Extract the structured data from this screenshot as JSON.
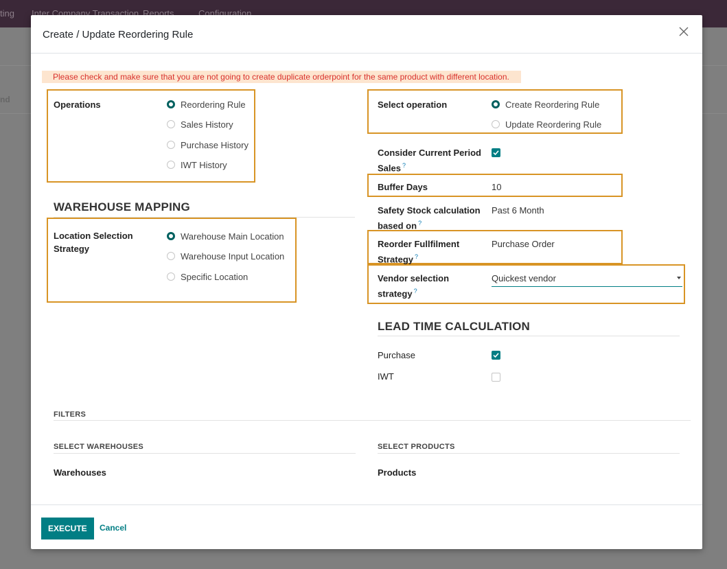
{
  "background": {
    "menu_items": [
      "ting",
      "Inter Company Transaction",
      "Reports",
      "Configuration"
    ],
    "left_label": "nd"
  },
  "modal": {
    "title": "Create / Update Reordering Rule",
    "warning": "Please check and make sure that you are not going to create duplicate orderpoint for the same product with different location."
  },
  "operations": {
    "label": "Operations",
    "options": [
      "Reordering Rule",
      "Sales History",
      "Purchase History",
      "IWT History"
    ],
    "selected": "Reordering Rule"
  },
  "select_operation": {
    "label": "Select operation",
    "options": [
      "Create Reordering Rule",
      "Update Reordering Rule"
    ],
    "selected": "Create Reordering Rule"
  },
  "consider_current_period": {
    "label_line1": "Consider Current Period",
    "label_line2": "Sales",
    "help": "?",
    "checked": true
  },
  "buffer_days": {
    "label": "Buffer Days",
    "value": "10"
  },
  "safety_stock": {
    "label_line1": "Safety Stock calculation",
    "label_line2": "based on",
    "help": "?",
    "value": "Past 6 Month"
  },
  "reorder_fulfilment": {
    "label_line1": "Reorder Fullfilment",
    "label_line2": "Strategy",
    "help": "?",
    "value": "Purchase Order"
  },
  "vendor_selection": {
    "label_line1": "Vendor selection",
    "label_line2": "strategy",
    "help": "?",
    "value": "Quickest vendor"
  },
  "warehouse_mapping": {
    "title": "WAREHOUSE MAPPING",
    "label_line1": "Location Selection",
    "label_line2": "Strategy",
    "options": [
      "Warehouse Main Location",
      "Warehouse Input Location",
      "Specific Location"
    ],
    "selected": "Warehouse Main Location"
  },
  "lead_time": {
    "title": "LEAD TIME CALCULATION",
    "purchase_label": "Purchase",
    "purchase_checked": true,
    "iwt_label": "IWT",
    "iwt_checked": false
  },
  "filters": {
    "title": "FILTERS",
    "warehouses_header": "SELECT WAREHOUSES",
    "warehouses_label": "Warehouses",
    "products_header": "SELECT PRODUCTS",
    "products_label": "Products"
  },
  "footer": {
    "execute_label": "EXECUTE",
    "cancel_label": "Cancel"
  },
  "colors": {
    "primary": "#017e84",
    "highlight_border": "#d89425",
    "warning_bg": "#fde5cf",
    "warning_text": "#d9302b",
    "navbar": "#3b2838"
  }
}
